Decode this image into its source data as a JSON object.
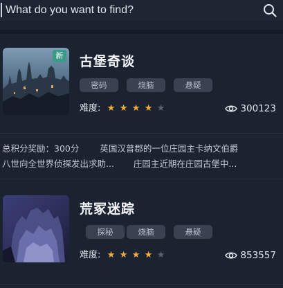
{
  "search": {
    "placeholder": "What do you want to find?",
    "icon": "search-icon"
  },
  "cards": [
    {
      "title": "古堡奇谈",
      "badge": "新",
      "tags": [
        "密码",
        "烧脑",
        "悬疑"
      ],
      "rating_label": "难度:",
      "rating": 4,
      "rating_max": 5,
      "views": "300123"
    },
    {
      "title": "荒冢迷踪",
      "tags": [
        "探秘",
        "烧脑",
        "悬疑"
      ],
      "rating_label": "难度:",
      "rating": 4,
      "rating_max": 5,
      "views": "853557"
    }
  ],
  "description": {
    "line1_left": "总积分奖励：300分",
    "line1_right": "英国汉普郡的一位庄园主卡纳文伯爵",
    "line2_left": "八世向全世界侦探发出求助...",
    "line2_right": "庄园主近期在庄园古堡中..."
  },
  "colors": {
    "background": "#1b2230",
    "star_on": "#f3ad3a",
    "star_off": "#5b616c",
    "badge": "#3a9c88",
    "tag_bg": "#3a4150"
  }
}
